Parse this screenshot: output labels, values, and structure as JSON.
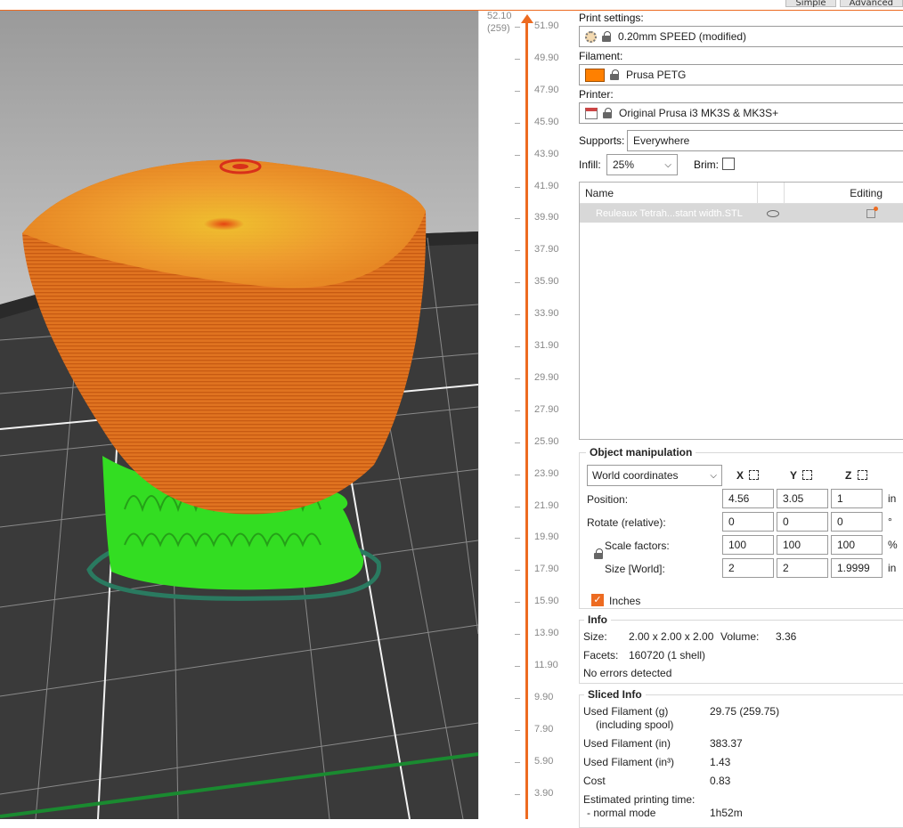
{
  "mode_tabs": [
    "Simple",
    "Advanced"
  ],
  "slider": {
    "top_value": "52.10",
    "top_layer": "(259)",
    "ticks": [
      "51.90",
      "49.90",
      "47.90",
      "45.90",
      "43.90",
      "41.90",
      "39.90",
      "37.90",
      "35.90",
      "33.90",
      "31.90",
      "29.90",
      "27.90",
      "25.90",
      "23.90",
      "21.90",
      "19.90",
      "17.90",
      "15.90",
      "13.90",
      "11.90",
      "9.90",
      "7.90",
      "5.90",
      "3.90"
    ]
  },
  "print_settings": {
    "label": "Print settings:",
    "value": "0.20mm SPEED (modified)"
  },
  "filament": {
    "label": "Filament:",
    "value": "Prusa PETG",
    "color": "#ff8000"
  },
  "printer": {
    "label": "Printer:",
    "value": "Original Prusa i3 MK3S & MK3S+"
  },
  "supports": {
    "label": "Supports:",
    "value": "Everywhere"
  },
  "infill": {
    "label": "Infill:",
    "value": "25%"
  },
  "brim": {
    "label": "Brim:"
  },
  "object_list": {
    "col_name": "Name",
    "col_editing": "Editing",
    "item": "Reuleaux Tetrah...stant width.STL"
  },
  "manip": {
    "title": "Object manipulation",
    "coords": "World coordinates",
    "axes": [
      "X",
      "Y",
      "Z"
    ],
    "rows": [
      {
        "label": "Position:",
        "values": [
          "4.56",
          "3.05",
          "1"
        ],
        "unit": "in"
      },
      {
        "label": "Rotate (relative):",
        "values": [
          "0",
          "0",
          "0"
        ],
        "unit": "°"
      },
      {
        "label": "Scale factors:",
        "values": [
          "100",
          "100",
          "100"
        ],
        "unit": "%"
      },
      {
        "label": "Size [World]:",
        "values": [
          "2",
          "2",
          "1.9999"
        ],
        "unit": "in"
      }
    ],
    "inches": "Inches"
  },
  "info": {
    "title": "Info",
    "size_label": "Size:",
    "size_value": "2.00 x 2.00 x 2.00",
    "volume_label": "Volume:",
    "volume_value": "3.36",
    "facets_label": "Facets:",
    "facets_value": "160720 (1 shell)",
    "errors": "No errors detected"
  },
  "sliced": {
    "title": "Sliced Info",
    "rows": [
      {
        "label": "Used Filament (g)",
        "sub": "(including spool)",
        "value": "29.75 (259.75)"
      },
      {
        "label": "Used Filament (in)",
        "value": "383.37"
      },
      {
        "label": "Used Filament (in³)",
        "value": "1.43"
      },
      {
        "label": "Cost",
        "value": "0.83"
      },
      {
        "label": "Estimated printing time:",
        "sub": "- normal mode",
        "value": "1h52m"
      }
    ]
  }
}
